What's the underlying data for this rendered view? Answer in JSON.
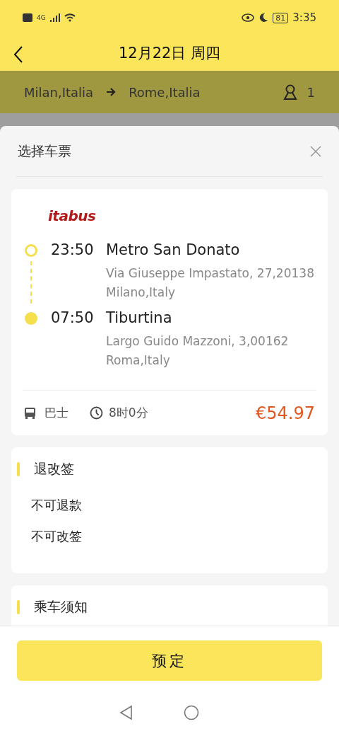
{
  "status_bar": {
    "network": "4G",
    "battery": "81",
    "time": "3:35"
  },
  "header": {
    "title": "12月22日 周四"
  },
  "route": {
    "from": "Milan,Italia",
    "to": "Rome,Italia",
    "passengers": "1"
  },
  "sheet": {
    "title": "选择车票",
    "ticket": {
      "operator": "itabus",
      "stops": [
        {
          "time": "23:50",
          "name": "Metro San Donato",
          "address": "Via Giuseppe Impastato, 27,20138 Milano,Italy",
          "kind": "departure"
        },
        {
          "time": "07:50",
          "name": "Tiburtina",
          "address": "Largo Guido Mazzoni, 3,00162 Roma,Italy",
          "kind": "arrival"
        }
      ],
      "vehicle": "巴士",
      "duration": "8时0分",
      "price": "€54.97"
    },
    "sections": [
      {
        "title": "退改签",
        "lines": [
          "不可退款",
          "不可改签"
        ]
      },
      {
        "title": "乘车须知"
      }
    ]
  },
  "book_button": "预定"
}
